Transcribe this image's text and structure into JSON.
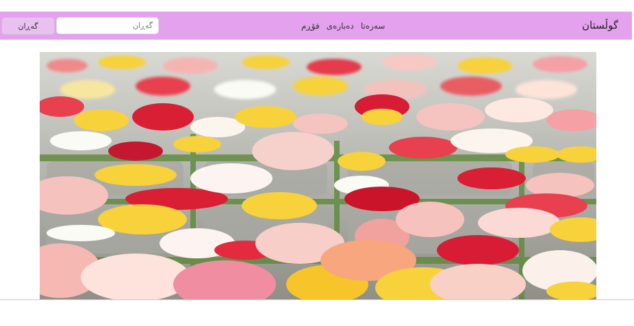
{
  "navbar": {
    "brand": "گوڵستان",
    "links": [
      {
        "label": "سەرەتا"
      },
      {
        "label": "دەبارەی"
      },
      {
        "label": "فۆڕم"
      }
    ],
    "search": {
      "placeholder": "گەڕان",
      "button_label": "گەڕان"
    },
    "color": "#e3a1ee"
  },
  "hero_image": {
    "icon": "rose-petals-photo"
  }
}
